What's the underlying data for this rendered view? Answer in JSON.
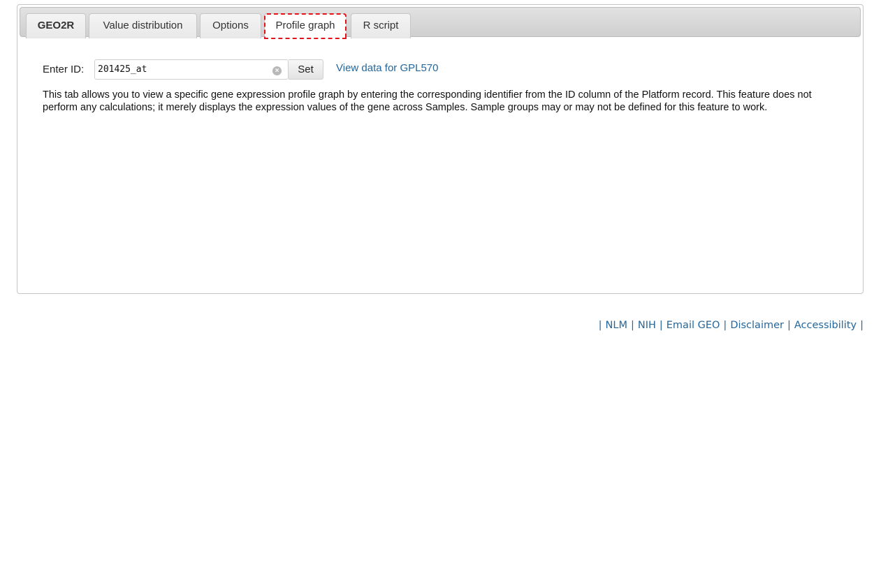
{
  "tabs": [
    {
      "label": "GEO2R"
    },
    {
      "label": "Value distribution"
    },
    {
      "label": "Options"
    },
    {
      "label": "Profile graph"
    },
    {
      "label": "R script"
    }
  ],
  "id_row": {
    "label": "Enter ID:",
    "value": "201425_at",
    "set_label": "Set",
    "link_text": "View data for GPL570"
  },
  "description": "This tab allows you to view a specific gene expression profile graph by entering the corresponding identifier from the ID column of the Platform record. This feature does not perform any calculations; it merely displays the expression values of the gene across Samples. Sample groups may or may not be defined for this feature to work.",
  "footer": {
    "links": [
      "NLM",
      "NIH",
      "Email GEO",
      "Disclaimer",
      "Accessibility"
    ]
  },
  "colors": {
    "link": "#25669b",
    "highlight": "#e0141a"
  },
  "icons": {
    "clear": "clear-circle-icon"
  }
}
